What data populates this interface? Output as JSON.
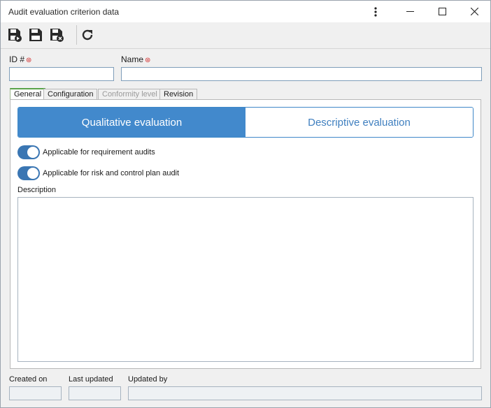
{
  "window": {
    "title": "Audit evaluation criterion data",
    "menu_icon": "vertical-ellipsis-icon",
    "minimize_icon": "minimize-icon",
    "maximize_icon": "maximize-icon",
    "close_icon": "close-icon"
  },
  "toolbar": {
    "tools": [
      {
        "name": "save-and-new-icon"
      },
      {
        "name": "save-icon"
      },
      {
        "name": "save-and-close-icon"
      },
      {
        "name": "refresh-icon"
      }
    ]
  },
  "form": {
    "id_label": "ID #",
    "id_value": "",
    "name_label": "Name",
    "name_value": "",
    "required_mark": "⊛"
  },
  "tabs": [
    {
      "label": "General",
      "state": "active"
    },
    {
      "label": "Configuration",
      "state": "normal"
    },
    {
      "label": "Conformity level",
      "state": "disabled"
    },
    {
      "label": "Revision",
      "state": "normal"
    }
  ],
  "general": {
    "segment": {
      "selected": "Qualitative evaluation",
      "other": "Descriptive evaluation"
    },
    "toggles": [
      {
        "label": "Applicable for requirement audits",
        "on": true
      },
      {
        "label": "Applicable for risk and control plan audit",
        "on": true
      }
    ],
    "description_label": "Description",
    "description_value": ""
  },
  "footer": {
    "created_on_label": "Created on",
    "created_on_value": "",
    "last_updated_label": "Last updated",
    "last_updated_value": "",
    "updated_by_label": "Updated by",
    "updated_by_value": ""
  },
  "colors": {
    "accent": "#4289cc",
    "toggle": "#3a76b3",
    "required": "#d32f2f",
    "active_tab": "#5aa34a"
  }
}
